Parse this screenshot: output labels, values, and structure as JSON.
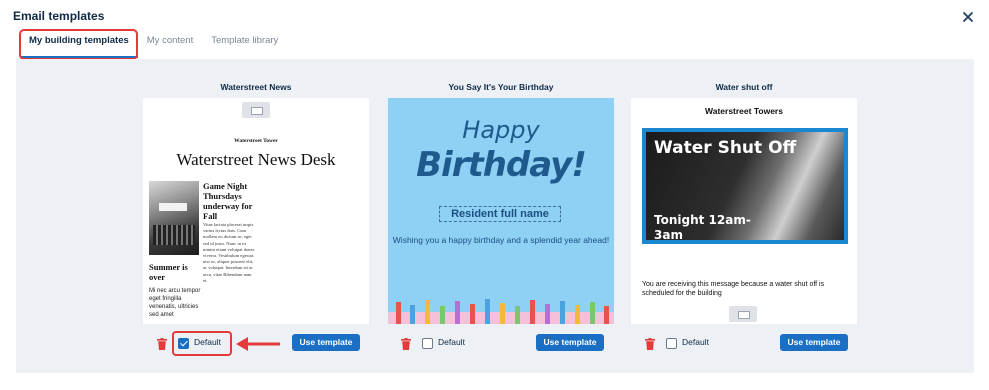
{
  "header": {
    "title": "Email templates",
    "close_icon": "close-icon"
  },
  "tabs": [
    {
      "label": "My building templates",
      "active": true
    },
    {
      "label": "My content",
      "active": false
    },
    {
      "label": "Template library",
      "active": false
    }
  ],
  "colors": {
    "accent": "#1a6fc4",
    "highlight": "#e53a3a",
    "panel": "#edf1f5",
    "delete": "#e53a3a"
  },
  "templates": [
    {
      "name": "Waterstreet News",
      "preview": {
        "masthead_small": "Waterstreet Tower",
        "masthead_big": "Waterstreet News Desk",
        "article1_title": "Game Night Thursdays underway for Fall",
        "article1_body": "Vitae lacinia placerat turpis varius lectus duis. Cum mollam eu dictum ac, eget sed id justo. Nunc in ex minim etiam volutpat donec viverra. Vestibulum egestas nisi ac, aliquet posuere elit, ac volutpat. Interdum sit ac arcu, vitae Bibendum nam et.",
        "article2_title": "Summer is over",
        "article2_body": "Mi nec arcu tempor eget fringilla venenatis, ultricies sed amet"
      },
      "default_label": "Default",
      "default_checked": true,
      "use_label": "Use template"
    },
    {
      "name": "You Say It's Your Birthday",
      "preview": {
        "happy": "Happy",
        "birthday": "Birthday!",
        "name_field": "Resident full name",
        "message": "Wishing you a happy birthday and a splendid year ahead!"
      },
      "default_label": "Default",
      "default_checked": false,
      "use_label": "Use template"
    },
    {
      "name": "Water shut off",
      "preview": {
        "building": "Waterstreet Towers",
        "headline": "Water Shut Off",
        "time": "Tonight 12am-3am",
        "message": "You are receiving this message because a water shut off is scheduled for the building"
      },
      "default_label": "Default",
      "default_checked": false,
      "use_label": "Use template"
    }
  ]
}
